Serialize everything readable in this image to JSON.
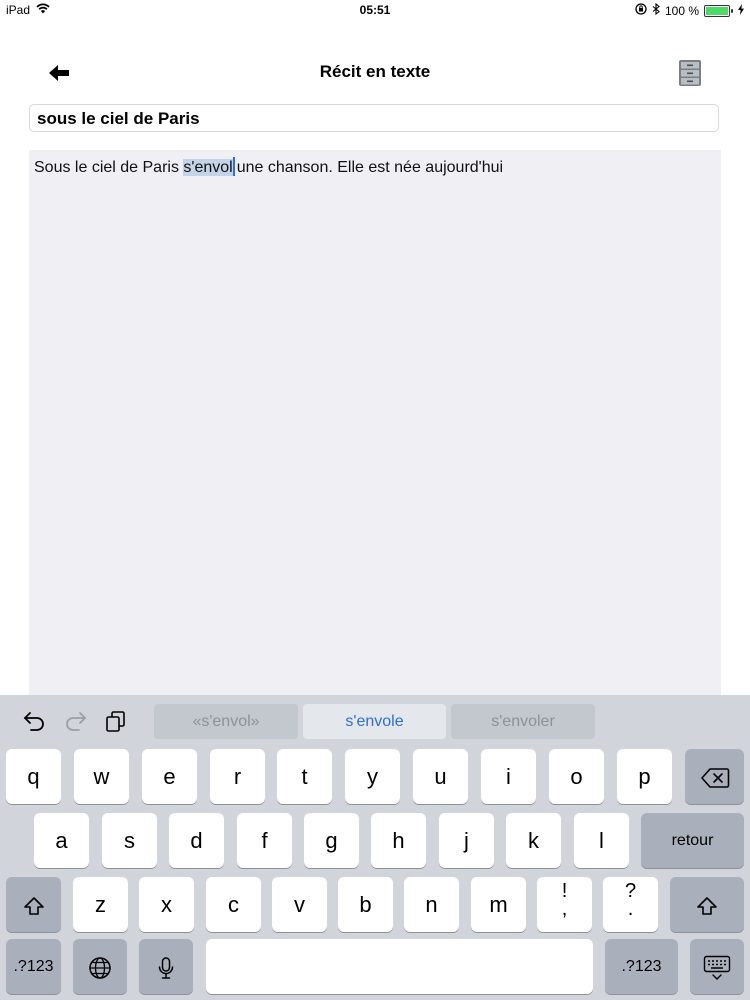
{
  "status_bar": {
    "device": "iPad",
    "time": "05:51",
    "battery": "100 %",
    "icons": [
      "wifi-icon",
      "lock-rotation-icon",
      "bluetooth-icon",
      "battery-icon",
      "charging-icon"
    ],
    "battery_color": "#4cd964"
  },
  "nav": {
    "title": "Récit en texte",
    "back_icon": "arrow-left-icon",
    "archive_icon": "filing-cabinet-icon"
  },
  "story": {
    "title_value": "sous le ciel de Paris",
    "text_before": "Sous le ciel de Paris ",
    "selected_word": "s'envol",
    "text_after": "une chanson. Elle est née aujourd'hui",
    "selection_color": "#c4d3e8",
    "caret_color": "#2f6fcf"
  },
  "keyboard": {
    "tools": [
      "undo-icon",
      "redo-icon",
      "paste-icon"
    ],
    "suggestions": [
      "«s'envol»",
      "s'envole",
      "s'envoler"
    ],
    "row1": [
      "q",
      "w",
      "e",
      "r",
      "t",
      "y",
      "u",
      "i",
      "o",
      "p"
    ],
    "row2": [
      "a",
      "s",
      "d",
      "f",
      "g",
      "h",
      "j",
      "k",
      "l"
    ],
    "row3": [
      "z",
      "x",
      "c",
      "v",
      "b",
      "n",
      "m"
    ],
    "punct1_top": "!",
    "punct1_bottom": ",",
    "punct2_top": "?",
    "punct2_bottom": ".",
    "return_label": "retour",
    "numbers_label": ".?123",
    "accent_color": "#2f6fcf"
  }
}
